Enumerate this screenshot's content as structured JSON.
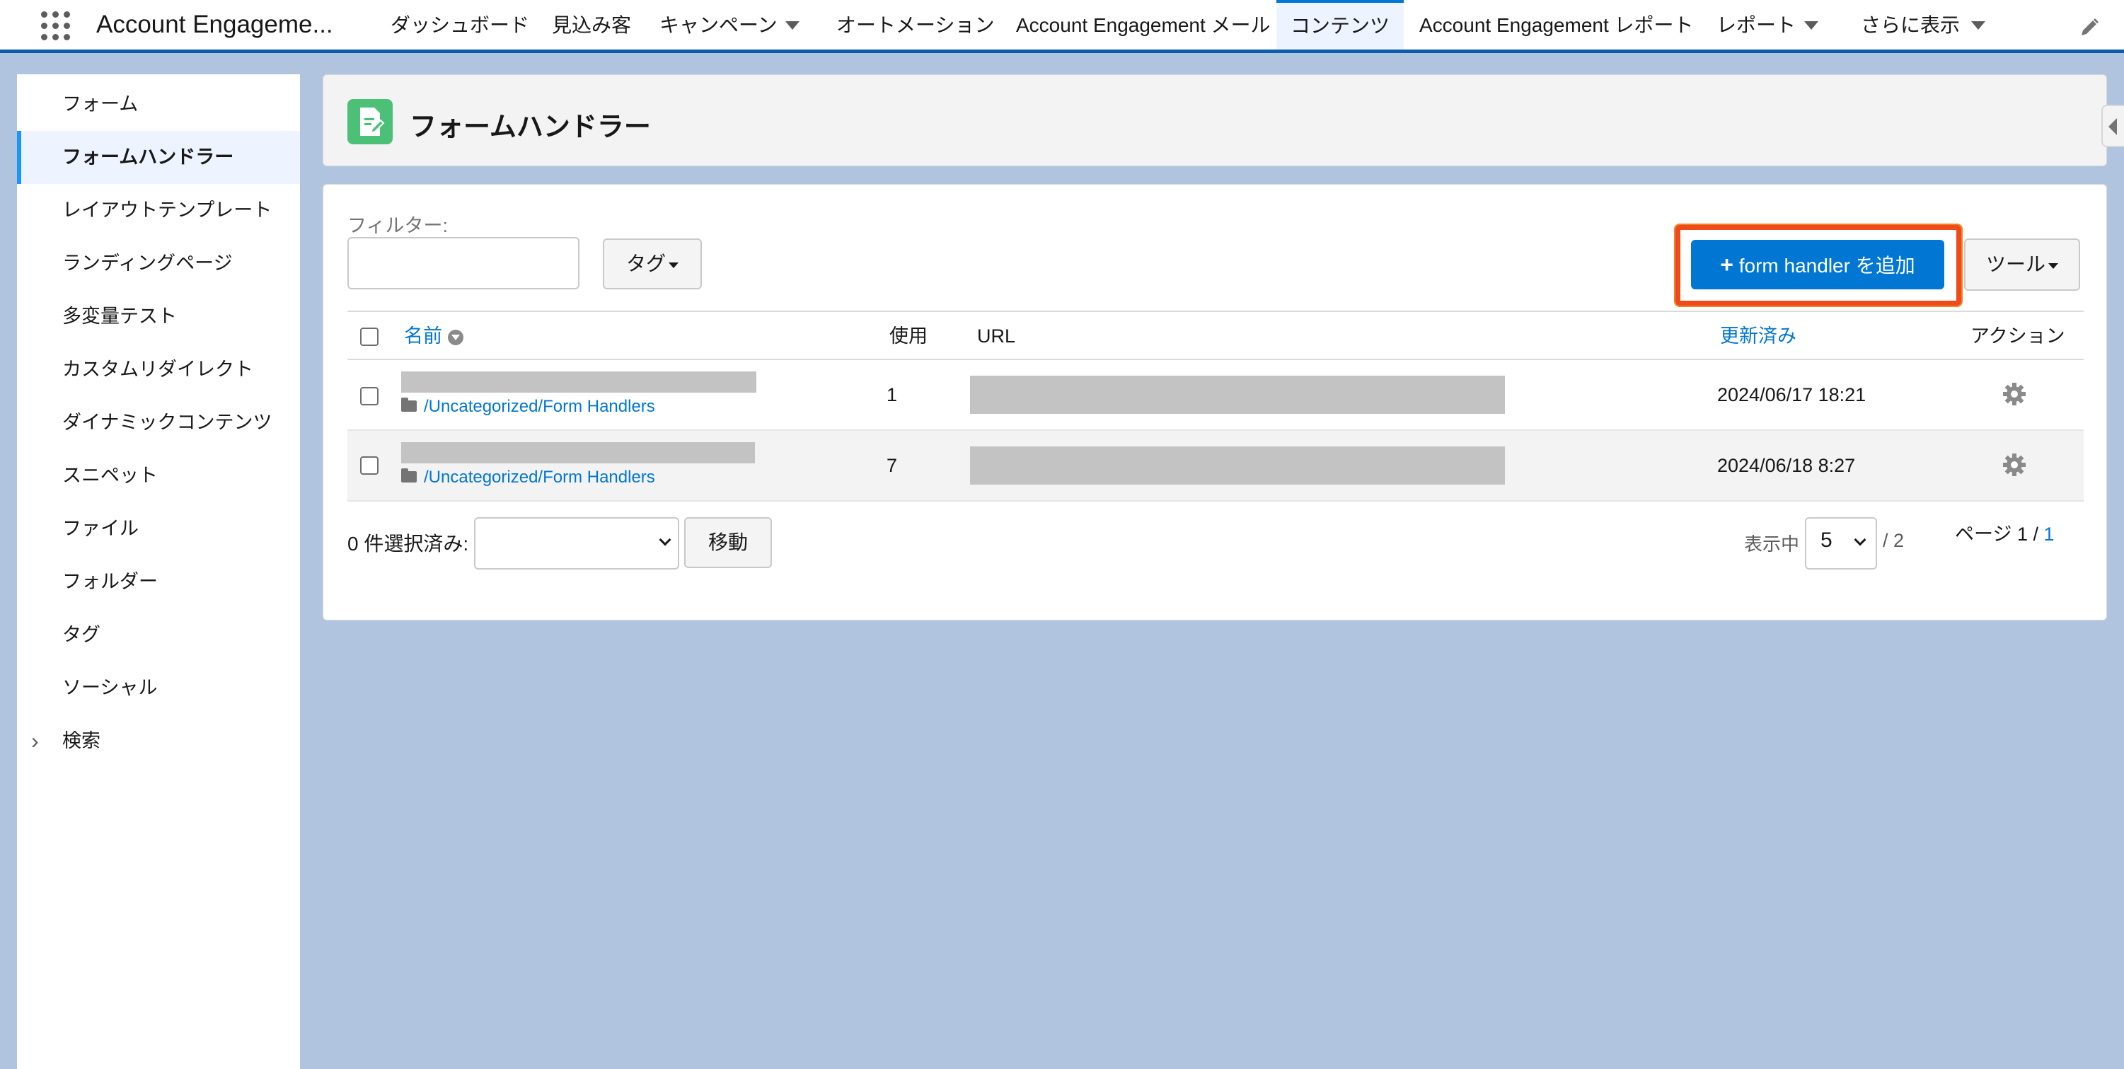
{
  "topnav": {
    "app_name": "Account Engageme...",
    "items": [
      {
        "label": "ダッシュボード"
      },
      {
        "label": "見込み客"
      },
      {
        "label": "キャンペーン"
      },
      {
        "label": "オートメーション"
      },
      {
        "label": "Account Engagement メール"
      },
      {
        "label": "コンテンツ"
      },
      {
        "label": "Account Engagement レポート"
      },
      {
        "label": "レポート"
      },
      {
        "label": "さらに表示"
      }
    ],
    "active_item": "コンテンツ"
  },
  "sidebar": {
    "items": [
      {
        "label": "フォーム"
      },
      {
        "label": "フォームハンドラー"
      },
      {
        "label": "レイアウトテンプレート"
      },
      {
        "label": "ランディングページ"
      },
      {
        "label": "多変量テスト"
      },
      {
        "label": "カスタムリダイレクト"
      },
      {
        "label": "ダイナミックコンテンツ"
      },
      {
        "label": "スニペット"
      },
      {
        "label": "ファイル"
      },
      {
        "label": "フォルダー"
      },
      {
        "label": "タグ"
      },
      {
        "label": "ソーシャル"
      },
      {
        "label": "検索"
      }
    ],
    "active_item": "フォームハンドラー"
  },
  "header": {
    "title": "フォームハンドラー",
    "icon": "form-handler-icon",
    "icon_color": "#4bc076"
  },
  "toolbar": {
    "filter_label": "フィルター:",
    "filter_value": "",
    "tag_button": "タグ",
    "add_button": "form handler を追加",
    "tools_button": "ツール",
    "highlight_color": "#ef4a1b"
  },
  "table": {
    "columns": {
      "name": "名前",
      "usage": "使用",
      "url": "URL",
      "updated": "更新済み",
      "actions": "アクション"
    },
    "rows": [
      {
        "folder": "/Uncategorized/Form Handlers",
        "usage": "1",
        "updated": "2024/06/17 18:21"
      },
      {
        "folder": "/Uncategorized/Form Handlers",
        "usage": "7",
        "updated": "2024/06/18 8:27"
      }
    ]
  },
  "footer": {
    "selected_label": "0 件選択済み:",
    "bulk_action_value": "",
    "move_button": "移動",
    "showing_label": "表示中",
    "page_size": "5",
    "total_pages": "/ 2",
    "page_label": "ページ 1 /",
    "page_link": "1"
  },
  "colors": {
    "brand_blue": "#0176d3",
    "nav_border": "#0b5cab",
    "background": "#b0c4df"
  }
}
